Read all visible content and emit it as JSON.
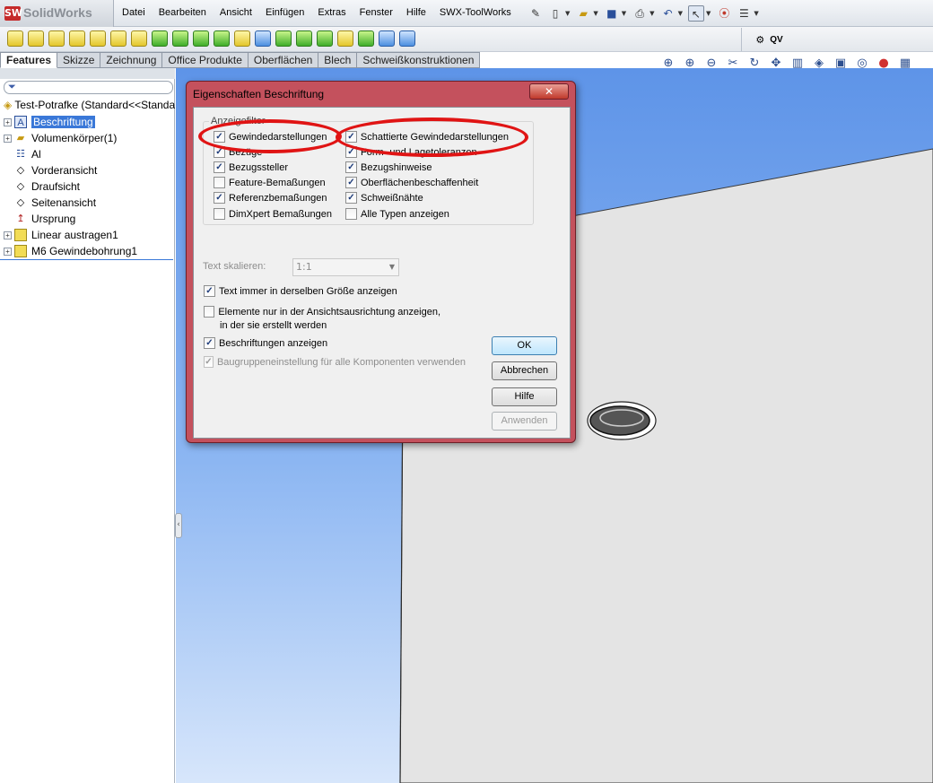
{
  "app": {
    "logo_mark": "SW",
    "logo_text": "SolidWorks",
    "menu": [
      "Datei",
      "Bearbeiten",
      "Ansicht",
      "Einfügen",
      "Extras",
      "Fenster",
      "Hilfe",
      "SWX-ToolWorks"
    ],
    "qv_label": "QV"
  },
  "tabs": [
    "Features",
    "Skizze",
    "Zeichnung",
    "Office Produkte",
    "Oberflächen",
    "Blech",
    "Schweißkonstruktionen"
  ],
  "tree": {
    "root": "Test-Potrafke  (Standard<<Standard",
    "items": [
      {
        "label": "Beschriftung",
        "expandable": true,
        "selected": true,
        "icon": "annotation-icon"
      },
      {
        "label": "Volumenkörper(1)",
        "expandable": true,
        "selected": false,
        "icon": "folder-icon"
      },
      {
        "label": "Al",
        "expandable": false,
        "selected": false,
        "icon": "material-icon"
      },
      {
        "label": "Vorderansicht",
        "expandable": false,
        "selected": false,
        "icon": "plane-icon"
      },
      {
        "label": "Draufsicht",
        "expandable": false,
        "selected": false,
        "icon": "plane-icon"
      },
      {
        "label": "Seitenansicht",
        "expandable": false,
        "selected": false,
        "icon": "plane-icon"
      },
      {
        "label": "Ursprung",
        "expandable": false,
        "selected": false,
        "icon": "origin-icon"
      },
      {
        "label": "Linear austragen1",
        "expandable": true,
        "selected": false,
        "icon": "extrude-icon"
      },
      {
        "label": "M6 Gewindebohrung1",
        "expandable": true,
        "selected": false,
        "icon": "hole-icon"
      }
    ]
  },
  "dialog": {
    "title": "Eigenschaften Beschriftung",
    "close_label": "✕",
    "group_label": "Anzeigefilter",
    "left_checks": [
      {
        "label": "Gewindedarstellungen",
        "checked": true
      },
      {
        "label": "Bezüge",
        "checked": true
      },
      {
        "label": "Bezugssteller",
        "checked": true
      },
      {
        "label": "Feature-Bemaßungen",
        "checked": false
      },
      {
        "label": "Referenzbemaßungen",
        "checked": true
      },
      {
        "label": "DimXpert Bemaßungen",
        "checked": false
      }
    ],
    "right_checks": [
      {
        "label": "Schattierte Gewindedarstellungen",
        "checked": true
      },
      {
        "label": "Form- und Lagetoleranzen",
        "checked": true
      },
      {
        "label": "Bezugshinweise",
        "checked": true
      },
      {
        "label": "Oberflächenbeschaffenheit",
        "checked": true
      },
      {
        "label": "Schweißnähte",
        "checked": true
      },
      {
        "label": "Alle Typen anzeigen",
        "checked": false
      }
    ],
    "scale_label": "Text skalieren:",
    "scale_value": "1:1",
    "option_text_size": "Text immer in derselben Größe anzeigen",
    "option_view_orient_1": "Elemente nur in der Ansichtsausrichtung anzeigen,",
    "option_view_orient_2": "in der sie erstellt werden",
    "option_show_annotations": "Beschriftungen anzeigen",
    "option_assembly": "Baugruppeneinstellung für alle Komponenten verwenden",
    "buttons": {
      "ok": "OK",
      "cancel": "Abbrechen",
      "help": "Hilfe",
      "apply": "Anwenden"
    }
  },
  "colors": {
    "highlight_ellipse": "#e01414",
    "selection": "#3a78d8",
    "dialog_frame": "#c4515d"
  }
}
